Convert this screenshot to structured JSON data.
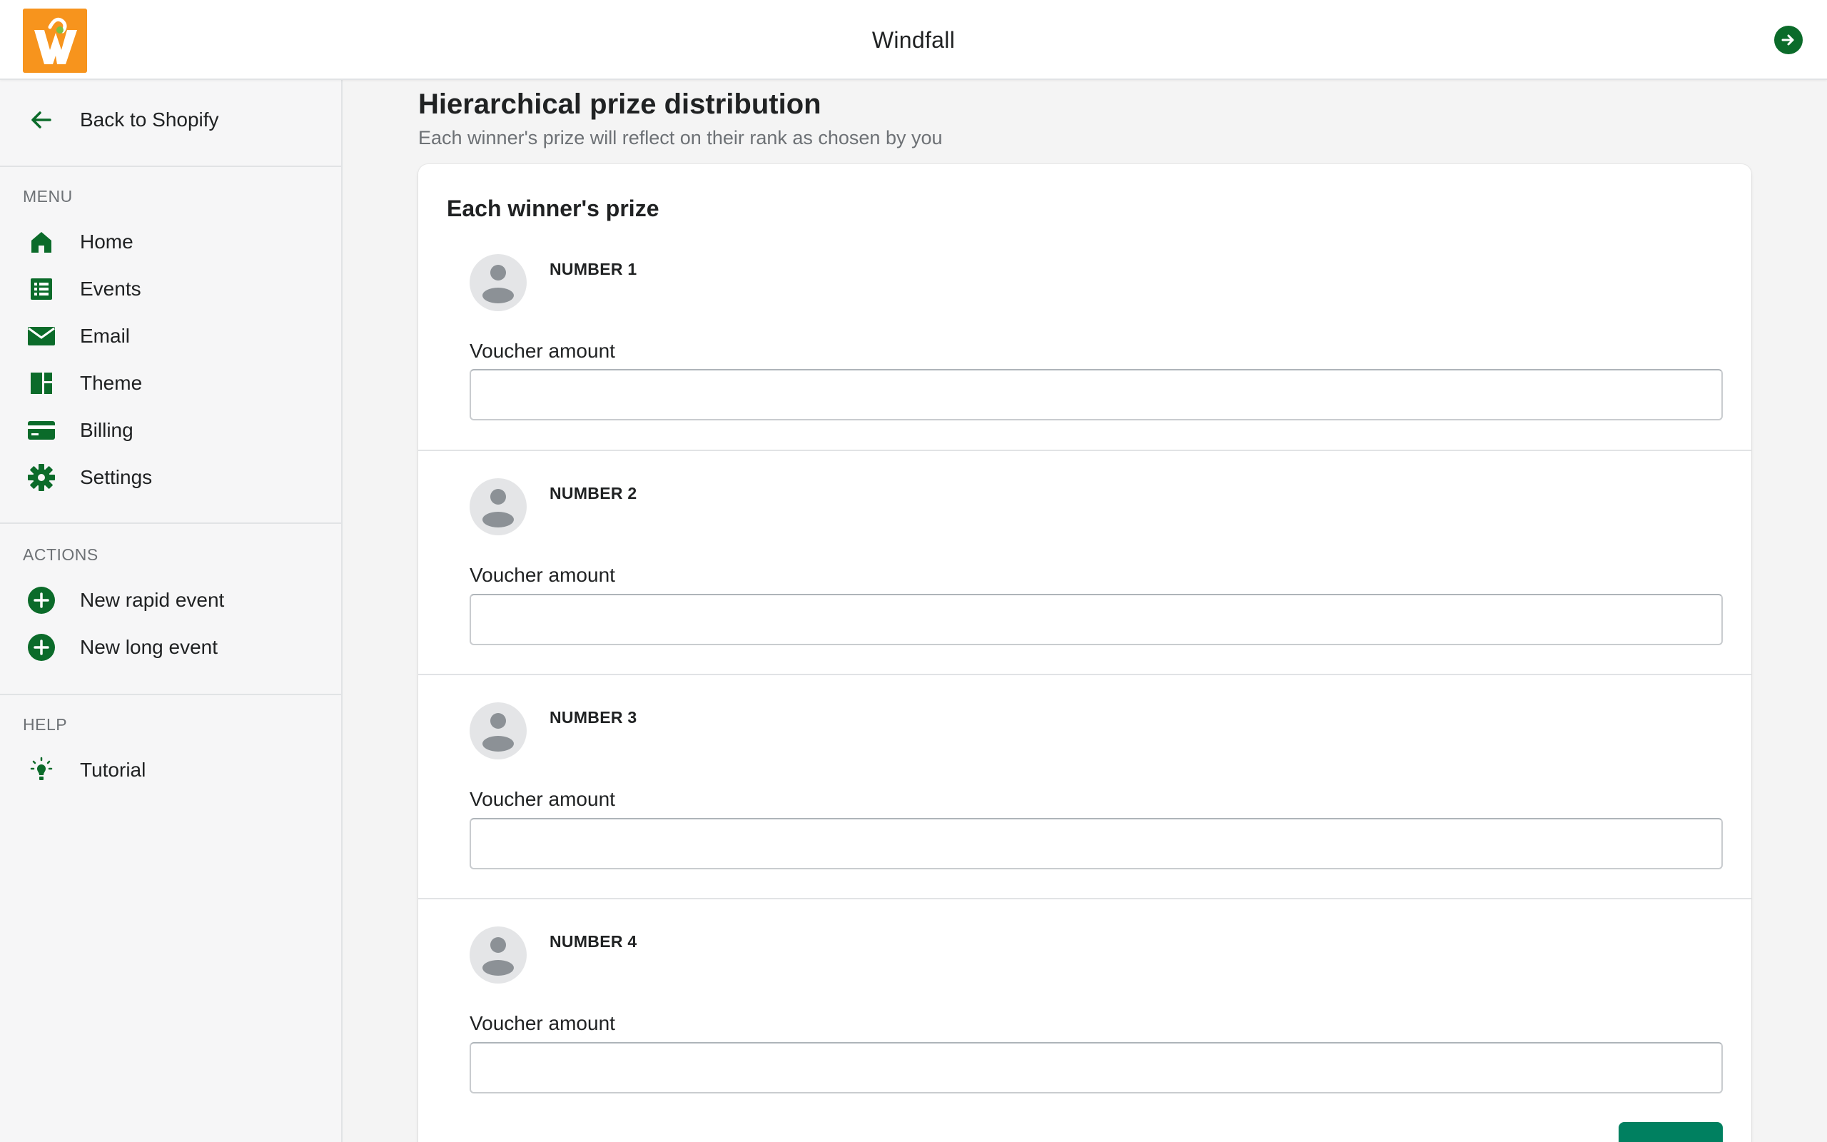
{
  "app": {
    "title": "Windfall",
    "logo_icon": "windfall-logo-icon",
    "logout_icon": "arrow-right-circle-icon",
    "brand_color": "#f7941d",
    "accent_color": "#0b6b2a"
  },
  "sidebar": {
    "back": {
      "label": "Back to Shopify",
      "icon": "arrow-left-icon"
    },
    "sections": [
      {
        "heading": "MENU",
        "items": [
          {
            "label": "Home",
            "icon": "home-icon"
          },
          {
            "label": "Events",
            "icon": "list-icon"
          },
          {
            "label": "Email",
            "icon": "mail-icon"
          },
          {
            "label": "Theme",
            "icon": "layout-icon"
          },
          {
            "label": "Billing",
            "icon": "credit-card-icon"
          },
          {
            "label": "Settings",
            "icon": "gear-icon"
          }
        ]
      },
      {
        "heading": "ACTIONS",
        "items": [
          {
            "label": "New rapid event",
            "icon": "plus-circle-icon"
          },
          {
            "label": "New long event",
            "icon": "plus-circle-icon"
          }
        ]
      },
      {
        "heading": "HELP",
        "items": [
          {
            "label": "Tutorial",
            "icon": "lightbulb-icon"
          }
        ]
      }
    ]
  },
  "main": {
    "title": "Hierarchical prize distribution",
    "subtitle": "Each winner's prize will reflect on their rank as chosen by you",
    "card": {
      "title": "Each winner's prize",
      "prizes": [
        {
          "rank": "NUMBER 1",
          "field_label": "Voucher amount",
          "value": ""
        },
        {
          "rank": "NUMBER 2",
          "field_label": "Voucher amount",
          "value": ""
        },
        {
          "rank": "NUMBER 3",
          "field_label": "Voucher amount",
          "value": ""
        },
        {
          "rank": "NUMBER 4",
          "field_label": "Voucher amount",
          "value": ""
        }
      ]
    },
    "primary_button_color": "#008060"
  }
}
